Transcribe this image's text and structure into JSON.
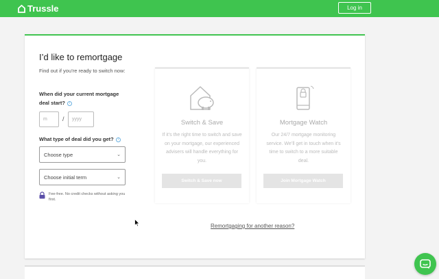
{
  "header": {
    "brand": "Trussle",
    "login_label": "Log in"
  },
  "form": {
    "title": "I’d like to remortgage",
    "subtitle": "Find out if you’re ready to switch now:",
    "q_start": "When did your current mortgage deal start?",
    "month_placeholder": "m",
    "separator": "/",
    "year_placeholder": "yyyy",
    "q_deal": "What type of deal did you get?",
    "deal_type_select": "Choose type",
    "initial_term_select": "Choose initial term",
    "fee_note": "Fee-free. No credit checks without asking you first."
  },
  "options": [
    {
      "title": "Switch & Save",
      "desc": "If it’s the right time to switch and save on your mortgage, our experienced advisers will handle everything for you.",
      "button": "Switch & Save now"
    },
    {
      "title": "Mortgage Watch",
      "desc": "Our 24/7 mortgage monitoring service. We’ll get in touch when it’s time to switch to a more suitable deal.",
      "button": "Join Mortgage Watch"
    }
  ],
  "other_reason_link": "Remortgaging for another reason?",
  "colors": {
    "brand_green": "#3fc44f",
    "info_blue": "#6ab0e0",
    "lock_purple": "#5b4fa8"
  },
  "icons": {
    "logo": "house-icon",
    "info": "info-icon",
    "lock": "lock-icon",
    "switch_save": "piggy-bank-house-icon",
    "mortgage_watch": "phone-icon",
    "chat": "chat-icon"
  }
}
